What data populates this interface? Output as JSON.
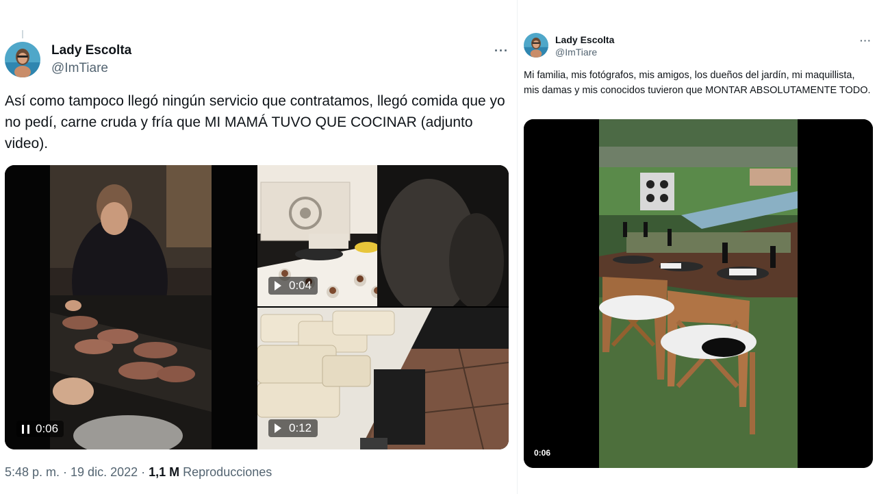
{
  "tweet1": {
    "author": {
      "name": "Lady Escolta",
      "handle": "@ImTiare"
    },
    "more_label": "···",
    "text": "Así como tampoco llegó ningún servicio que contratamos, llegó comida que yo no pedí, carne cruda y fría que MI MAMÁ TUVO QUE COCINAR (adjunto video).",
    "videos": [
      {
        "duration": "0:06",
        "state": "playing",
        "icon": "pause-icon"
      },
      {
        "duration": "0:04",
        "state": "paused",
        "icon": "play-icon"
      },
      {
        "duration": "0:12",
        "state": "paused",
        "icon": "play-icon"
      }
    ],
    "meta": {
      "time": "5:48 p. m. · 19 dic. 2022 · ",
      "views_count": "1,1 M",
      "views_label": " Reproducciones"
    }
  },
  "tweet2": {
    "author": {
      "name": "Lady Escolta",
      "handle": "@ImTiare"
    },
    "more_label": "···",
    "text": "Mi familia, mis fotógrafos, mis amigos, los dueños del jardín, mi maquillista, mis damas y mis conocidos tuvieron que MONTAR ABSOLUTAMENTE TODO.",
    "video": {
      "duration": "0:06"
    }
  },
  "colors": {
    "text": "#0f1419",
    "secondary": "#536471",
    "overlay": "rgba(0,0,0,0.55)"
  }
}
